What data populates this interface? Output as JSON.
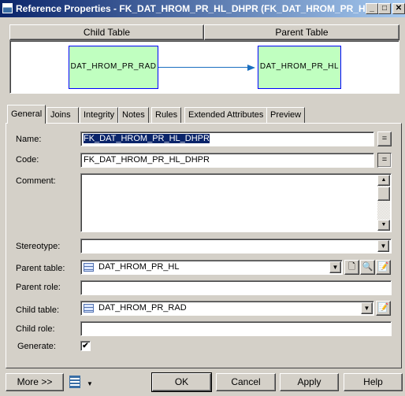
{
  "window": {
    "title": "Reference Properties - FK_DAT_HROM_PR_HL_DHPR (FK_DAT_HROM_PR_HL..."
  },
  "diagram": {
    "child_header": "Child Table",
    "parent_header": "Parent Table",
    "child_table": "DAT_HROM_PR_RAD",
    "parent_table": "DAT_HROM_PR_HL",
    "arrow_color": "#1a6fc0"
  },
  "tabs": [
    {
      "label": "General"
    },
    {
      "label": "Joins"
    },
    {
      "label": "Integrity"
    },
    {
      "label": "Notes"
    },
    {
      "label": "Rules"
    },
    {
      "label": "Extended Attributes"
    },
    {
      "label": "Preview"
    }
  ],
  "form": {
    "name_label": "Name:",
    "name_value": "FK_DAT_HROM_PR_HL_DHPR",
    "code_label": "Code:",
    "code_value": "FK_DAT_HROM_PR_HL_DHPR",
    "eq": "=",
    "comment_label": "Comment:",
    "comment_value": "",
    "stereotype_label": "Stereotype:",
    "stereotype_value": "",
    "parent_table_label": "Parent table:",
    "parent_table_value": "DAT_HROM_PR_HL",
    "parent_role_label": "Parent role:",
    "parent_role_value": "",
    "child_table_label": "Child table:",
    "child_table_value": "DAT_HROM_PR_RAD",
    "child_role_label": "Child role:",
    "child_role_value": "",
    "generate_label": "Generate:",
    "generate_checked": true
  },
  "buttons": {
    "more": "More >>",
    "ok": "OK",
    "cancel": "Cancel",
    "apply": "Apply",
    "help": "Help"
  }
}
